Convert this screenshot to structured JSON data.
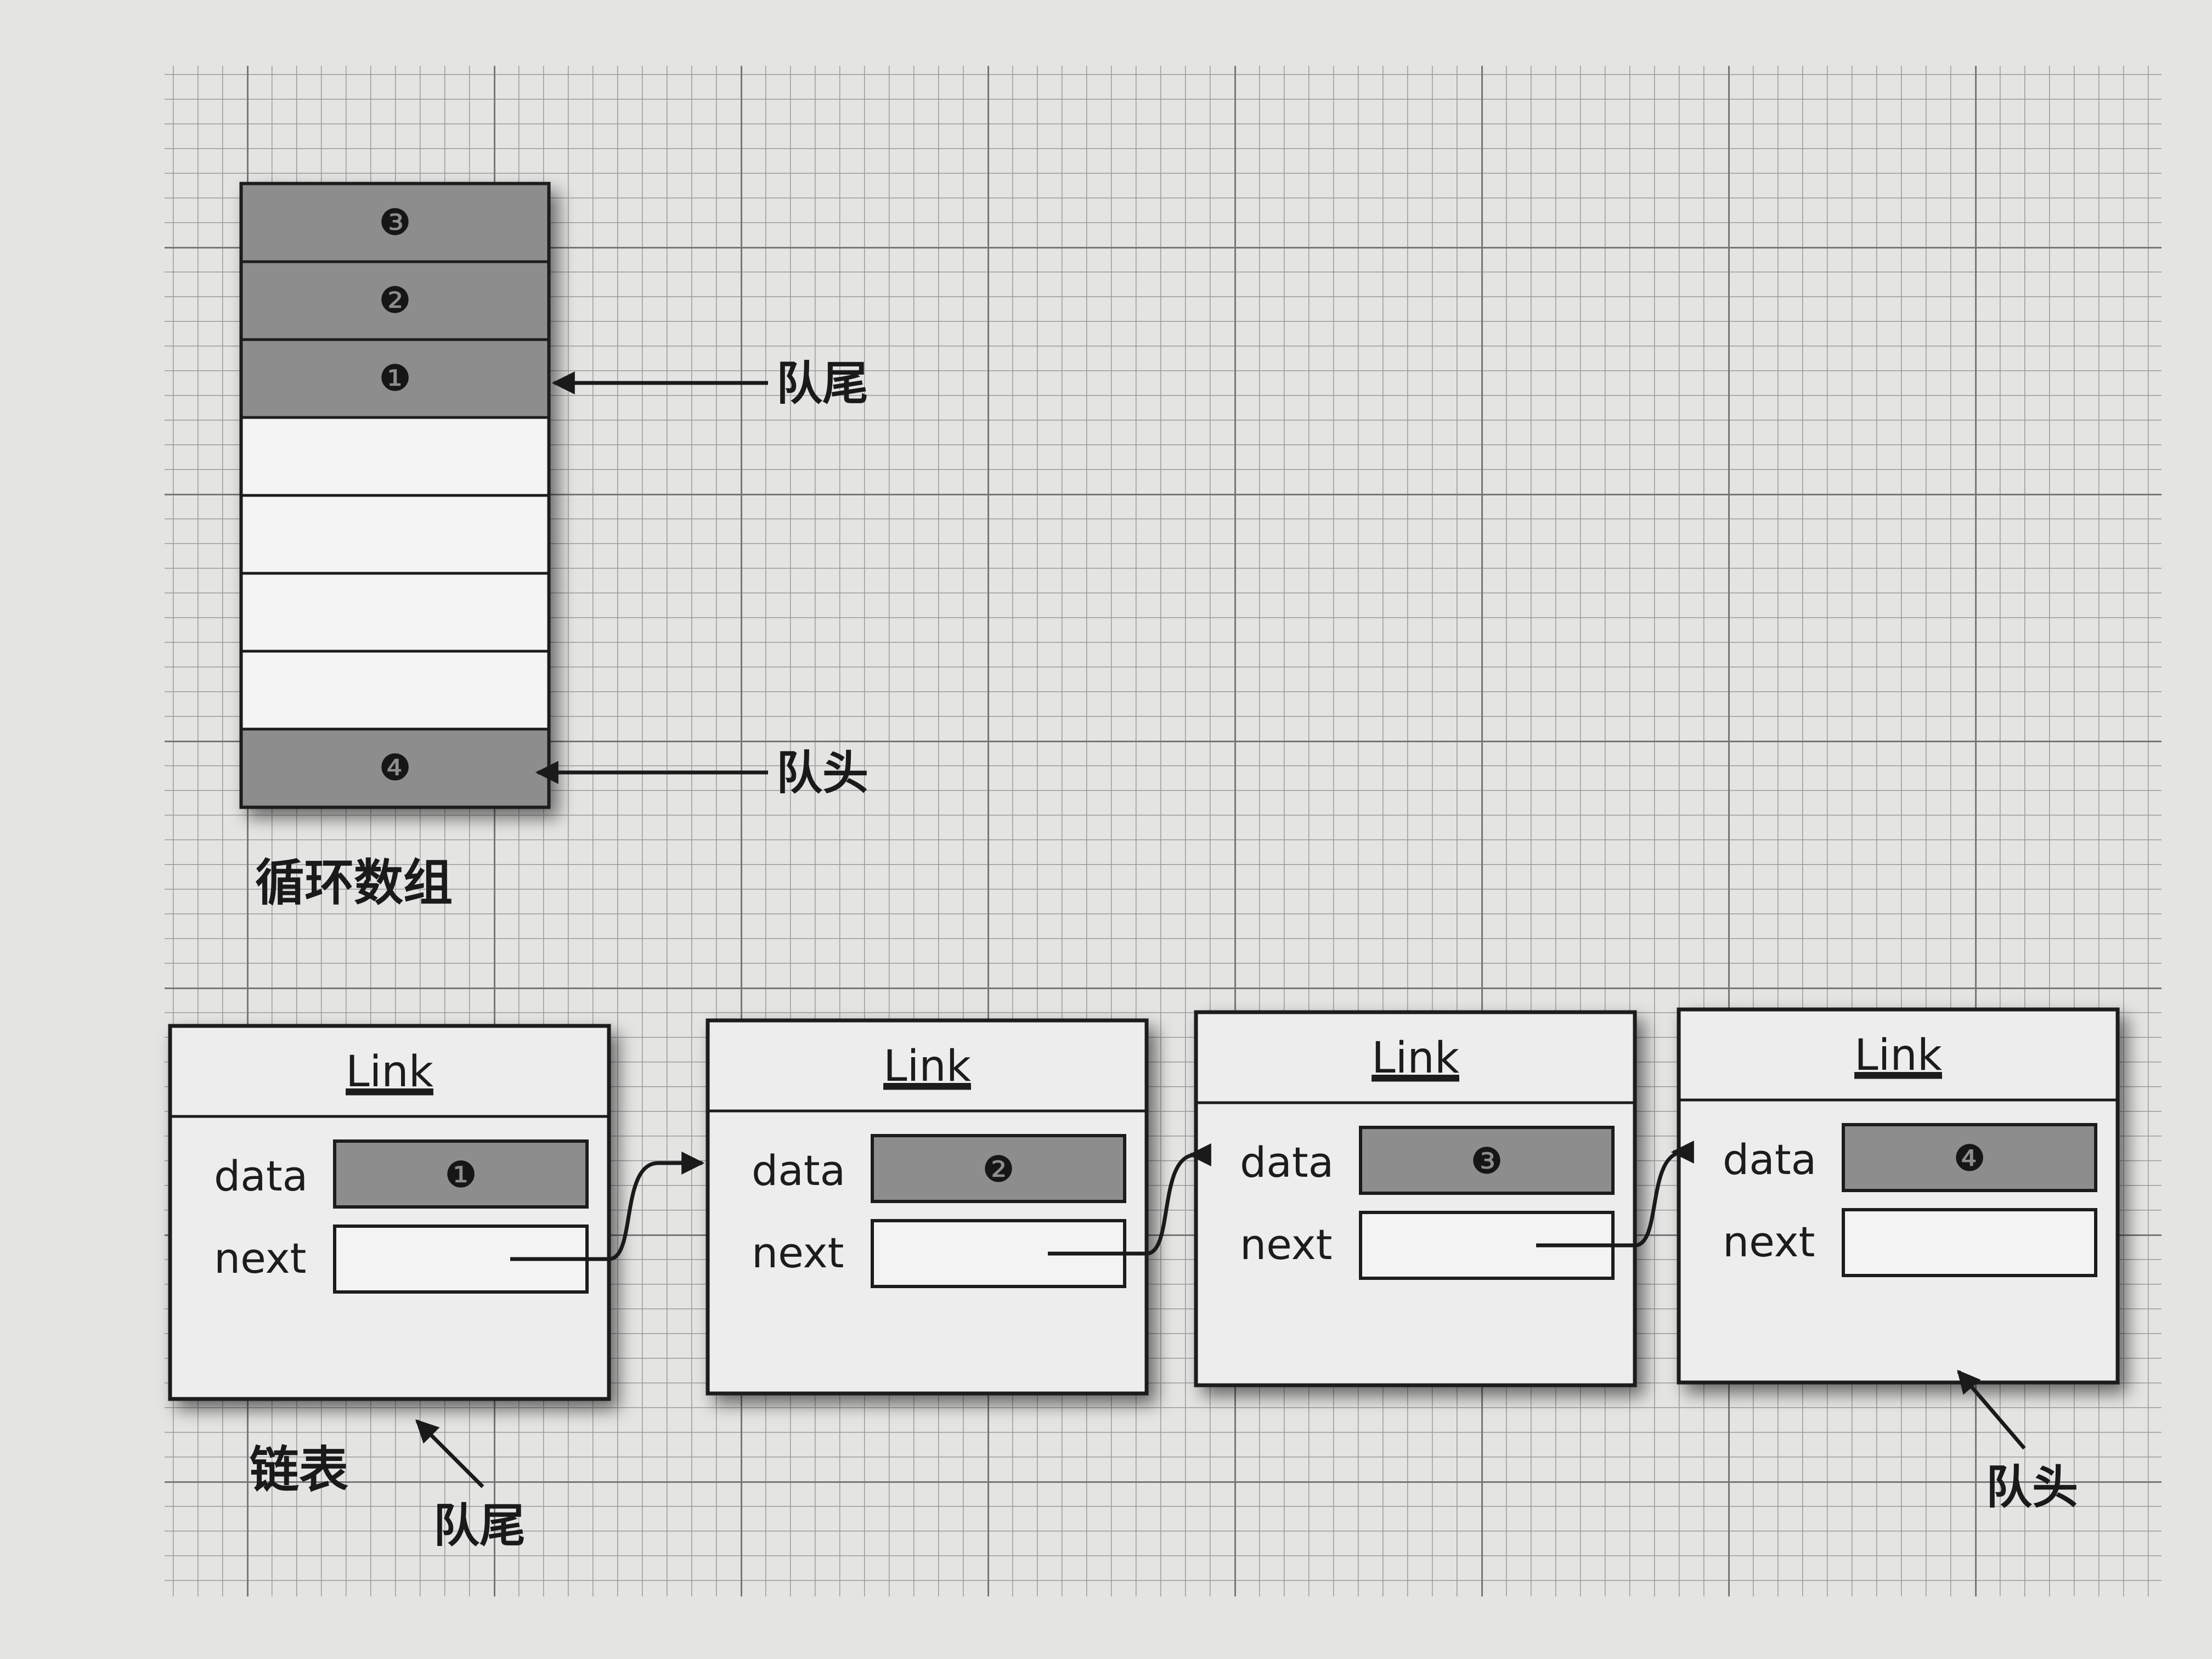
{
  "colors": {
    "background": "#bdbdbd",
    "paper": "#e4e4e2",
    "grid": "#9a9a9a",
    "cell_filled": "#8d8d8d",
    "cell_empty": "#f4f4f4",
    "ink": "#1a1a1a"
  },
  "circular_array": {
    "caption": "循环数组",
    "cells": [
      {
        "marker": "❸",
        "filled": true
      },
      {
        "marker": "❷",
        "filled": true
      },
      {
        "marker": "❶",
        "filled": true
      },
      {
        "marker": "",
        "filled": false
      },
      {
        "marker": "",
        "filled": false
      },
      {
        "marker": "",
        "filled": false
      },
      {
        "marker": "",
        "filled": false
      },
      {
        "marker": "❹",
        "filled": true
      }
    ],
    "tail_label": "队尾",
    "head_label": "队头"
  },
  "linked_list": {
    "caption": "链表",
    "nodes": [
      {
        "title": "Link",
        "data_label": "data",
        "next_label": "next",
        "marker": "❶",
        "has_next": true
      },
      {
        "title": "Link",
        "data_label": "data",
        "next_label": "next",
        "marker": "❷",
        "has_next": true
      },
      {
        "title": "Link",
        "data_label": "data",
        "next_label": "next",
        "marker": "❸",
        "has_next": true
      },
      {
        "title": "Link",
        "data_label": "data",
        "next_label": "next",
        "marker": "❹",
        "has_next": false
      }
    ],
    "tail_label": "队尾",
    "head_label": "队头"
  }
}
